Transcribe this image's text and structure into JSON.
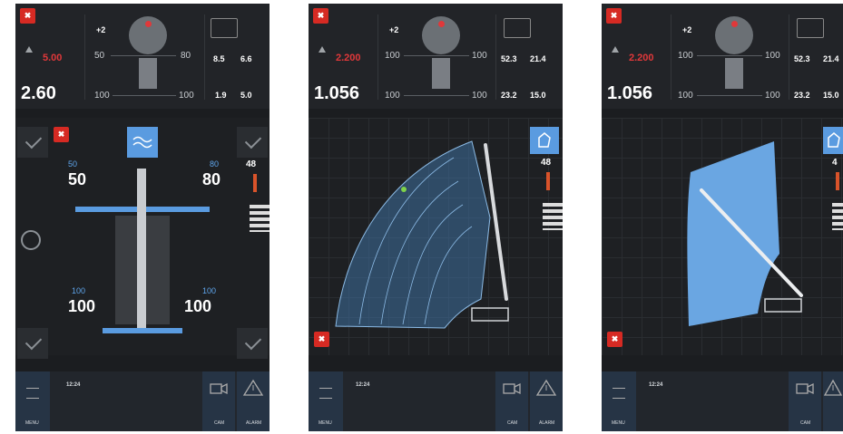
{
  "screens": [
    {
      "logo": "✖",
      "load_top": "5.00",
      "load_big": "2.60",
      "plus": "+2",
      "left_top": "50",
      "right_top": "80",
      "left_bottom": "100",
      "right_bottom": "100",
      "rb_top_left": "8.5",
      "rb_top_right": "6.6",
      "rb_bot_left": "1.9",
      "rb_bot_right": "5.0",
      "out_left_top_small": "50",
      "out_left_top": "50",
      "out_right_top_small": "80",
      "out_right_top": "80",
      "out_left_bot_small": "100",
      "out_left_bot": "100",
      "out_right_bot_small": "100",
      "out_right_bot": "100",
      "side_value": "48",
      "time": "12:24",
      "menu_label": "MENU",
      "cam_label": "CAM",
      "alarm_label": "ALARM"
    },
    {
      "logo": "✖",
      "load_top": "2.200",
      "load_big": "1.056",
      "plus": "+2",
      "left_top": "100",
      "right_top": "100",
      "left_bottom": "100",
      "right_bottom": "100",
      "rb_top_left": "52.3",
      "rb_top_right": "21.4",
      "rb_bot_left": "23.2",
      "rb_bot_right": "15.0",
      "side_value": "48",
      "time": "12:24",
      "menu_label": "MENU",
      "cam_label": "CAM",
      "alarm_label": "ALARM"
    },
    {
      "logo": "✖",
      "load_top": "2.200",
      "load_big": "1.056",
      "plus": "+2",
      "left_top": "100",
      "right_top": "100",
      "left_bottom": "100",
      "right_bottom": "100",
      "rb_top_left": "52.3",
      "rb_top_right": "21.4",
      "rb_bot_left": "23.2",
      "rb_bot_right": "15.0",
      "side_value": "4",
      "time": "12:24",
      "menu_label": "MENU",
      "cam_label": "CAM",
      "alarm_label": "ALARM"
    }
  ],
  "colors": {
    "accent_blue": "#5a9be0",
    "brand_red": "#d62a23",
    "background": "#1b1d20"
  },
  "icons": {
    "logo": "brand-logo-icon",
    "warning": "warning-triangle-icon",
    "camera": "camera-icon",
    "alarm": "alarm-icon",
    "settings": "gear-icon",
    "check": "check-icon",
    "wave": "wave-icon",
    "working_area": "working-area-icon",
    "menu": "menu-icon"
  }
}
